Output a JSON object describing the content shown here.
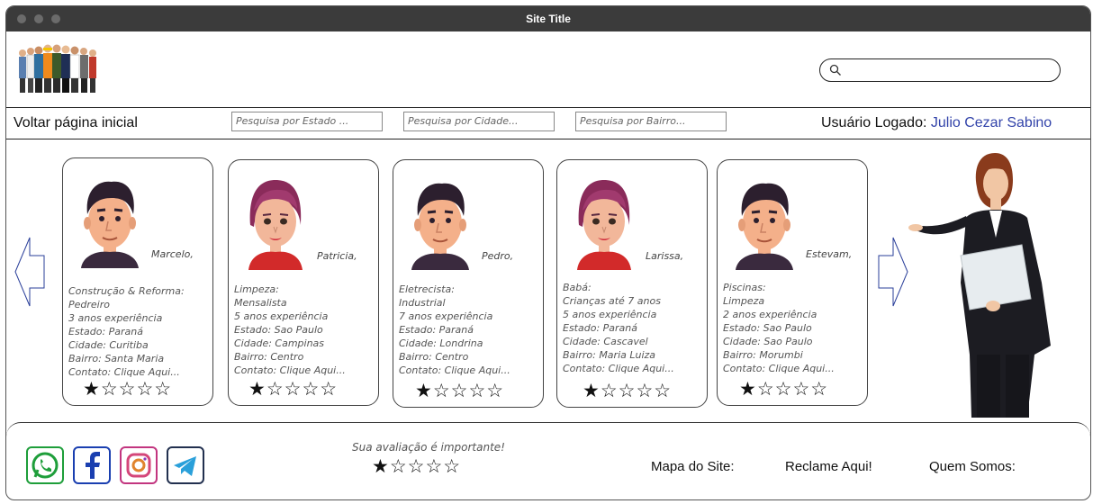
{
  "window": {
    "title": "Site Title"
  },
  "header": {
    "logo_icon": "workers-group-logo",
    "search_placeholder": ""
  },
  "navbar": {
    "back_label": "Voltar página inicial",
    "filters": {
      "estado_placeholder": "Pesquisa por Estado ...",
      "cidade_placeholder": "Pesquisa por Cidade...",
      "bairro_placeholder": "Pesquisa por Bairro..."
    },
    "user_label": "Usuário Logado:",
    "user_name": "Julio Cezar Sabino"
  },
  "cards": [
    {
      "name": "Marcelo,",
      "avatar": "male-avatar",
      "rating": 1,
      "lines": [
        "Construção & Reforma:",
        "Pedreiro",
        "3 anos experiência",
        "Estado: Paraná",
        "Cidade: Curitiba",
        "Bairro: Santa Maria",
        "Contato: Clique Aqui..."
      ]
    },
    {
      "name": "Patricia,",
      "avatar": "female-avatar",
      "rating": 1,
      "lines": [
        "Limpeza:",
        "Mensalista",
        "5 anos experiência",
        "Estado: Sao Paulo",
        "Cidade: Campinas",
        "Bairro: Centro",
        "Contato: Clique Aqui..."
      ]
    },
    {
      "name": "Pedro,",
      "avatar": "male-avatar",
      "rating": 1,
      "lines": [
        "Eletrecista:",
        "Industrial",
        "7 anos experiência",
        "Estado: Paraná",
        "Cidade: Londrina",
        "Bairro: Centro",
        "Contato: Clique Aqui..."
      ]
    },
    {
      "name": "Larissa,",
      "avatar": "female-avatar",
      "rating": 1,
      "lines": [
        "Babá:",
        "Crianças até 7 anos",
        "5 anos experiência",
        "Estado: Paraná",
        "Cidade: Cascavel",
        "Bairro: Maria Luiza",
        "Contato: Clique Aqui..."
      ]
    },
    {
      "name": "Estevam,",
      "avatar": "male-avatar",
      "rating": 1,
      "lines": [
        "Piscinas:",
        "Limpeza",
        "2 anos experiência",
        "Estado: Sao Paulo",
        "Cidade: Sao Paulo",
        "Bairro: Morumbi",
        "Contato: Clique Aqui..."
      ]
    }
  ],
  "footer": {
    "social_icons": [
      "whatsapp-icon",
      "facebook-icon",
      "instagram-icon",
      "telegram-icon"
    ],
    "rating_message": "Sua avaliação é importante!",
    "rating": 1,
    "links": [
      "Mapa do Site:",
      "Reclame Aqui!",
      "Quem Somos:"
    ]
  },
  "colors": {
    "title_bar": "#3b3b3b",
    "user_name": "#3344aa",
    "arrow_outline": "#2a3f9a"
  }
}
